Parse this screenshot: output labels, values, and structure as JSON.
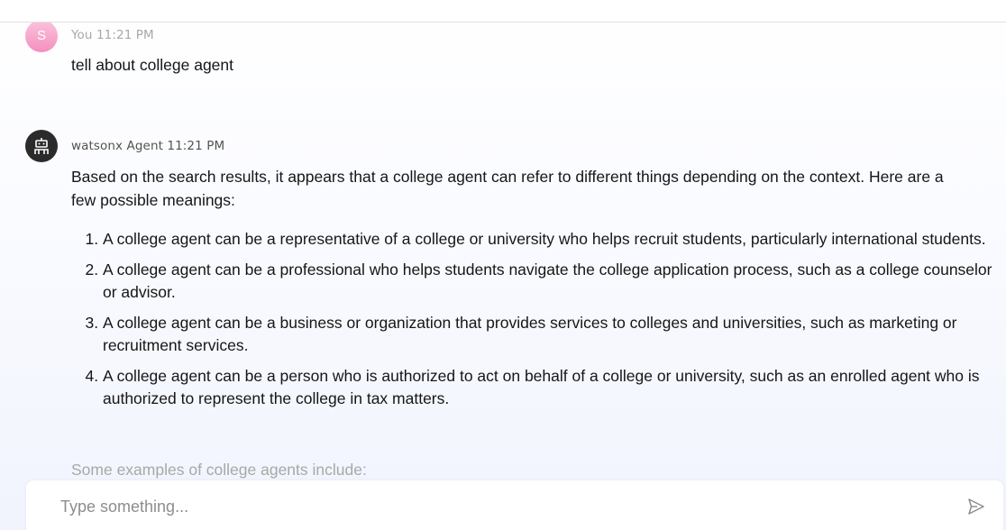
{
  "conversation": {
    "user_message": {
      "avatar_initial": "S",
      "author": "You",
      "time": "11:21 PM",
      "text": "tell about college agent"
    },
    "agent_message": {
      "author": "watsonx Agent",
      "time": "11:21 PM",
      "intro": "Based on the search results, it appears that a college agent can refer to different things depending on the context. Here are a few possible meanings:",
      "items": [
        "A college agent can be a representative of a college or university who helps recruit students, particularly international students.",
        "A college agent can be a professional who helps students navigate the college application process, such as a college counselor or advisor.",
        "A college agent can be a business or organization that provides services to colleges and universities, such as marketing or recruitment services.",
        "A college agent can be a person who is authorized to act on behalf of a college or university, such as an enrolled agent who is authorized to represent the college in tax matters."
      ],
      "trailing_text": "Some examples of college agents include:"
    }
  },
  "composer": {
    "placeholder": "Type something..."
  },
  "icons": {
    "agent_avatar": "robot-icon",
    "send": "send-icon"
  },
  "colors": {
    "user_avatar": "#f48fbd",
    "agent_avatar": "#2b2b2b"
  }
}
